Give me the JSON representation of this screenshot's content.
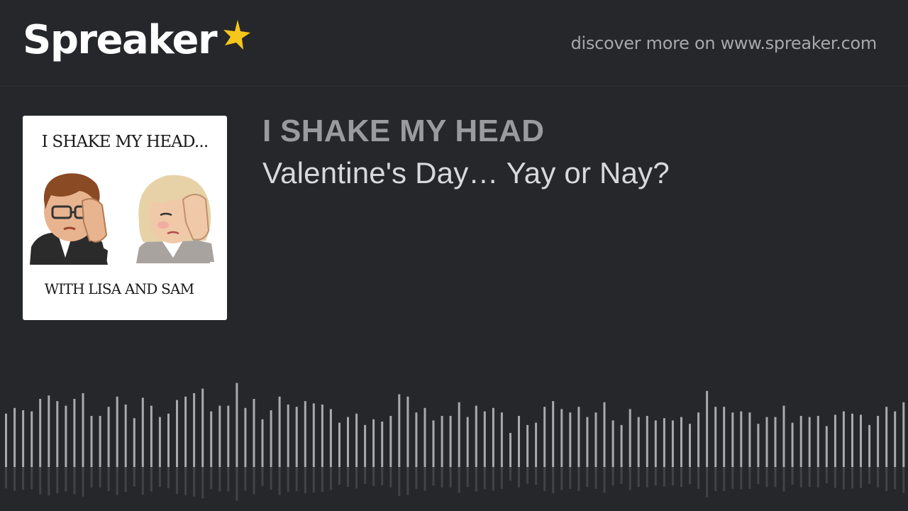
{
  "brand": {
    "name": "Spreaker",
    "star_color": "#f5c61b",
    "discover_text": "discover more on www.spreaker.com"
  },
  "cover_art": {
    "title_text": "I SHAKE MY HEAD...",
    "subtitle_text": "WITH LISA AND SAM"
  },
  "show": {
    "title": "I SHAKE MY HEAD",
    "episode_title": "Valentine's Day… Yay or Nay?"
  },
  "waveform": {
    "color": "#a9aaac",
    "levels": [
      0.47,
      0.52,
      0.5,
      0.49,
      0.6,
      0.63,
      0.58,
      0.54,
      0.6,
      0.65,
      0.45,
      0.45,
      0.53,
      0.62,
      0.55,
      0.43,
      0.61,
      0.54,
      0.44,
      0.47,
      0.59,
      0.62,
      0.65,
      0.69,
      0.49,
      0.54,
      0.54,
      0.74,
      0.52,
      0.6,
      0.42,
      0.5,
      0.62,
      0.55,
      0.53,
      0.58,
      0.56,
      0.55,
      0.51,
      0.39,
      0.44,
      0.47,
      0.37,
      0.42,
      0.4,
      0.45,
      0.64,
      0.62,
      0.48,
      0.52,
      0.41,
      0.45,
      0.45,
      0.57,
      0.44,
      0.54,
      0.49,
      0.52,
      0.48,
      0.3,
      0.45,
      0.37,
      0.39,
      0.53,
      0.58,
      0.51,
      0.48,
      0.53,
      0.44,
      0.48,
      0.57,
      0.41,
      0.37,
      0.51,
      0.44,
      0.45,
      0.41,
      0.43,
      0.41,
      0.44,
      0.38,
      0.48,
      0.67,
      0.53,
      0.53,
      0.48,
      0.49,
      0.48,
      0.38,
      0.44,
      0.44,
      0.54,
      0.39,
      0.45,
      0.44,
      0.45,
      0.36,
      0.46,
      0.49,
      0.47,
      0.46,
      0.37,
      0.45,
      0.53,
      0.49,
      0.57,
      0.52,
      0.38
    ]
  }
}
